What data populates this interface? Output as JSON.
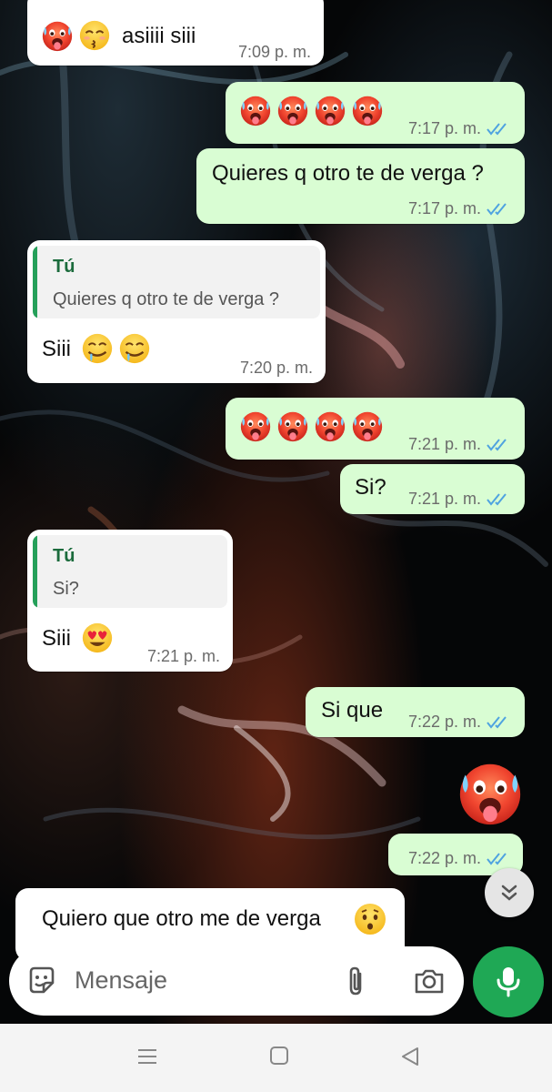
{
  "colors": {
    "outgoing_bubble": "#d9fdd3",
    "incoming_bubble": "#ffffff",
    "read_ticks": "#4fa3e0",
    "mic_button": "#1fa855",
    "quote_bar": "#25a05a"
  },
  "messages": [
    {
      "direction": "in",
      "text": "asiiii siii",
      "emojis": [
        "hot-face-emoji",
        "kissing-face-emoji"
      ],
      "time": "7:09 p. m."
    },
    {
      "direction": "out",
      "text": "",
      "emojis": [
        "hot-face-emoji",
        "hot-face-emoji",
        "hot-face-emoji",
        "hot-face-emoji"
      ],
      "time": "7:17 p. m.",
      "status": "read"
    },
    {
      "direction": "out",
      "text": "Quieres q otro te de verga ?",
      "time": "7:17 p. m.",
      "status": "read"
    },
    {
      "direction": "in",
      "quote_author": "Tú",
      "quote_text": "Quieres q otro te de verga ?",
      "text": "Siii",
      "emojis": [
        "drooling-face-emoji",
        "drooling-face-emoji"
      ],
      "time": "7:20 p. m."
    },
    {
      "direction": "out",
      "text": "",
      "emojis": [
        "hot-face-emoji",
        "hot-face-emoji",
        "hot-face-emoji",
        "hot-face-emoji"
      ],
      "time": "7:21 p. m.",
      "status": "read"
    },
    {
      "direction": "out",
      "text": "Si?",
      "time": "7:21 p. m.",
      "status": "read"
    },
    {
      "direction": "in",
      "quote_author": "Tú",
      "quote_text": "Si?",
      "text": "Siii",
      "emojis": [
        "heart-eyes-emoji"
      ],
      "time": "7:21 p. m."
    },
    {
      "direction": "out",
      "text": "Si que",
      "time": "7:22 p. m.",
      "status": "read"
    },
    {
      "direction": "out",
      "text": "",
      "emojis": [
        "hot-face-emoji"
      ],
      "time": "7:22 p. m.",
      "status": "read"
    },
    {
      "direction": "in",
      "text": "Quiero que otro me de verga",
      "emojis": [
        "hushed-face-emoji"
      ],
      "time": ""
    }
  ],
  "composer": {
    "placeholder": "Mensaje",
    "icons": [
      "sticker-icon",
      "paperclip-icon",
      "camera-icon",
      "microphone-icon"
    ]
  },
  "scroll_button": {
    "icon": "double-chevron-down-icon"
  },
  "navbar": {
    "icons": [
      "recent-apps-icon",
      "home-icon",
      "back-icon"
    ]
  }
}
